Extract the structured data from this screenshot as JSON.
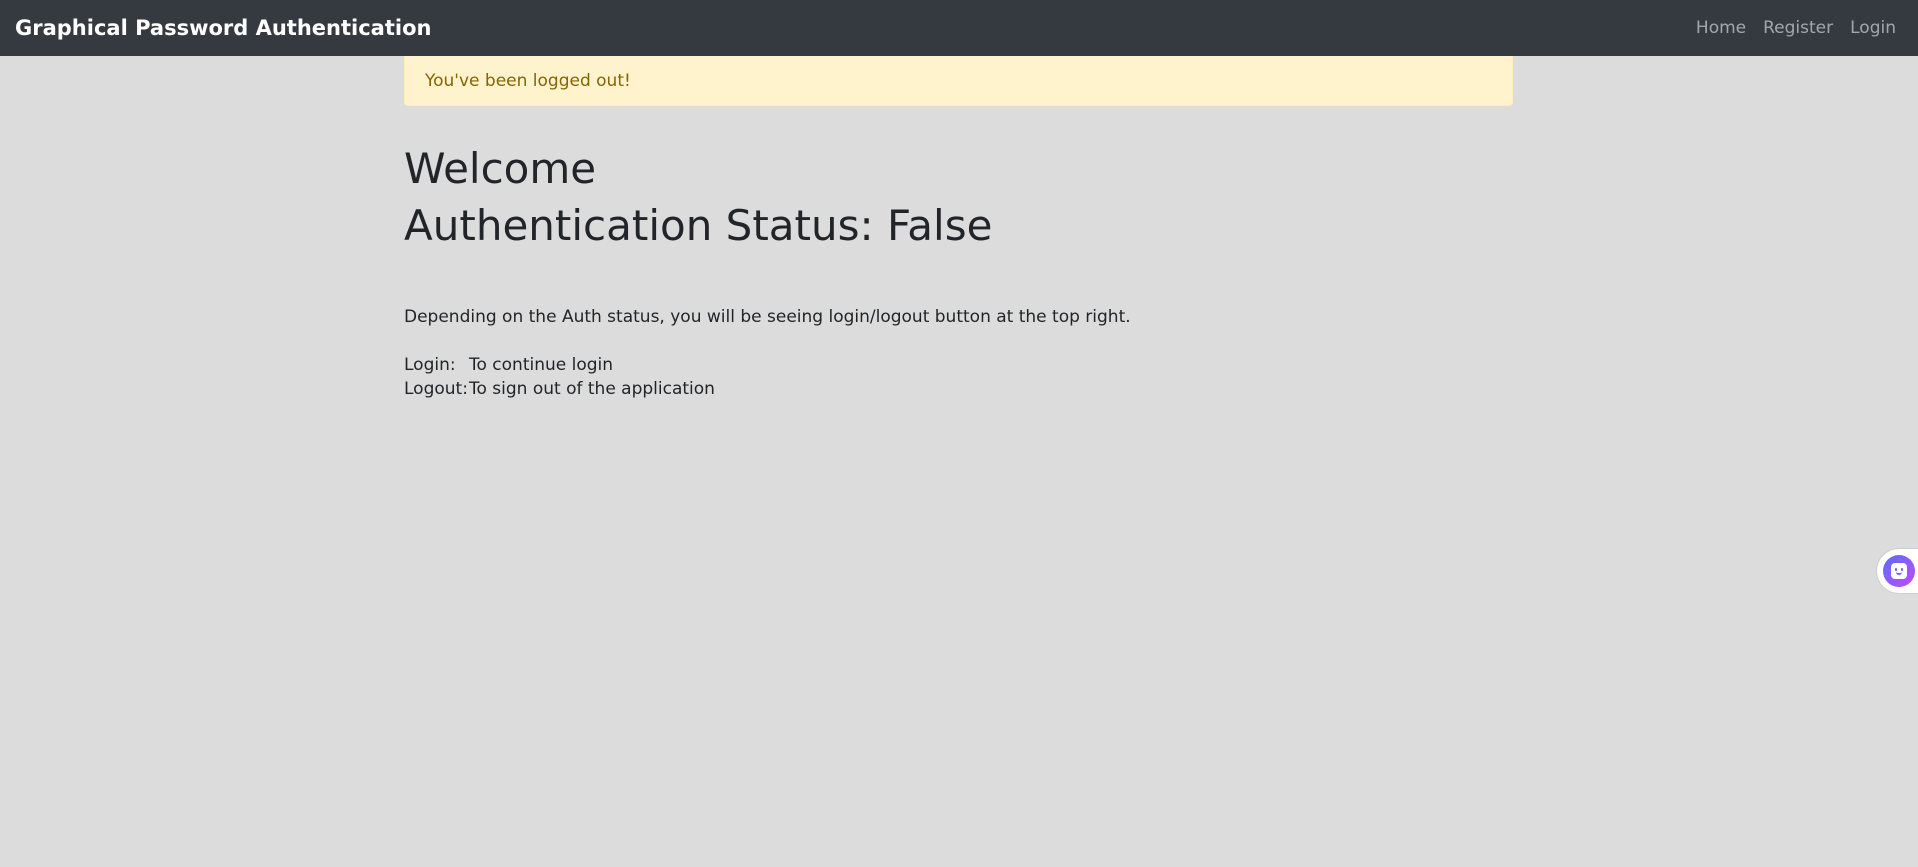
{
  "navbar": {
    "brand": "Graphical Password Authentication",
    "links": [
      "Home",
      "Register",
      "Login"
    ],
    "background": "#343a40"
  },
  "alert": {
    "message": "You've been logged out!",
    "background": "#fff3cd"
  },
  "main": {
    "welcome": "Welcome",
    "auth_status": "Authentication Status: False",
    "description": "Depending on the Auth status, you will be seeing login/logout button at the top right.",
    "definitions": [
      {
        "term": "Login:",
        "text": "To continue login"
      },
      {
        "term": "Logout:",
        "text": "To sign out of the application"
      }
    ]
  },
  "assistant": {
    "icon": "assistant-face-icon"
  }
}
